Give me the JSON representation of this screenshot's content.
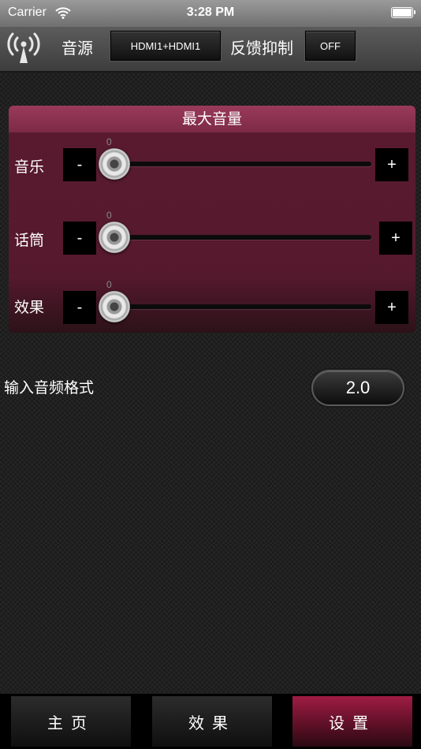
{
  "status_bar": {
    "carrier": "Carrier",
    "time": "3:28 PM"
  },
  "top_bar": {
    "source_label": "音源",
    "source_value": "HDMI1+HDMI1",
    "feedback_label": "反馈抑制",
    "feedback_value": "OFF"
  },
  "max_volume": {
    "title": "最大音量",
    "rows": [
      {
        "label": "音乐",
        "value": "0",
        "level": 0,
        "minus": "-",
        "plus": "+"
      },
      {
        "label": "话筒",
        "value": "0",
        "level": 0,
        "minus": "-",
        "plus": "+"
      },
      {
        "label": "效果",
        "value": "0",
        "level": 0,
        "minus": "-",
        "plus": "+"
      }
    ]
  },
  "input_format": {
    "label": "输入音频格式",
    "value": "2.0"
  },
  "tabs": [
    {
      "label": "主页",
      "active": false
    },
    {
      "label": "效果",
      "active": false
    },
    {
      "label": "设置",
      "active": true
    }
  ],
  "colors": {
    "accent": "#8a2a4a",
    "panel": "#55192d",
    "active_tab": "#a01c45"
  }
}
